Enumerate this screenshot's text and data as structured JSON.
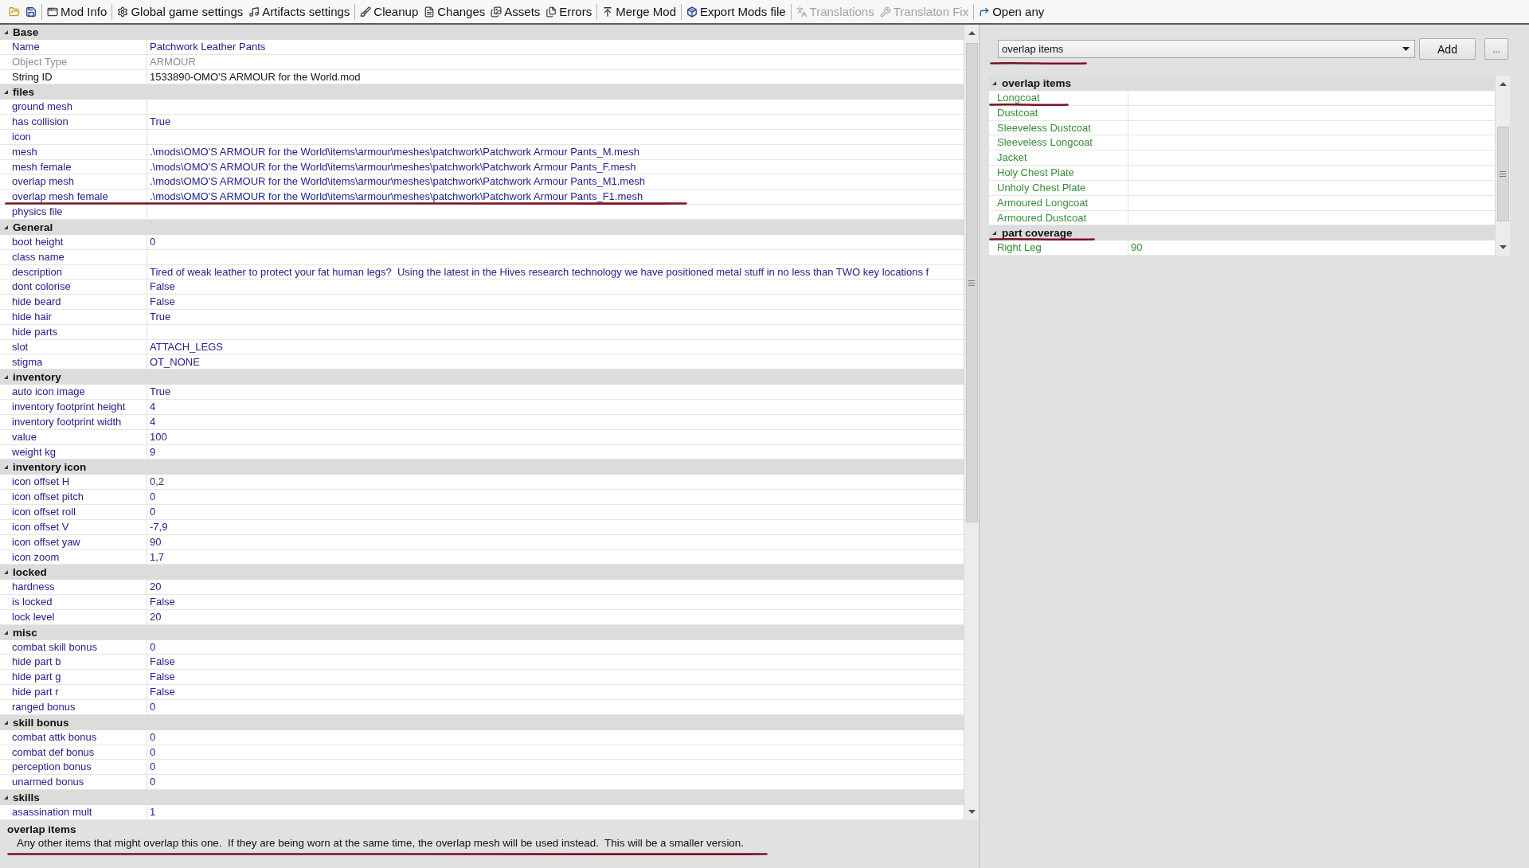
{
  "toolbar": {
    "groups": [
      {
        "buttons": [
          {
            "disabled": false
          },
          {
            "disabled": false
          }
        ]
      },
      {
        "buttons": [
          {
            "label": "Mod Info",
            "disabled": false
          }
        ]
      },
      {
        "buttons": [
          {
            "label": "Global game settings",
            "disabled": false
          },
          {
            "label": "Artifacts settings",
            "disabled": false
          }
        ]
      },
      {
        "buttons": [
          {
            "label": "Cleanup",
            "disabled": false
          },
          {
            "label": "Changes",
            "disabled": false
          },
          {
            "label": "Assets",
            "disabled": false
          },
          {
            "label": "Errors",
            "disabled": false
          }
        ]
      },
      {
        "buttons": [
          {
            "label": "Merge Mod",
            "disabled": false
          }
        ]
      },
      {
        "buttons": [
          {
            "label": "Export Mods file",
            "disabled": false
          }
        ]
      },
      {
        "buttons": [
          {
            "label": "Translations",
            "disabled": true
          },
          {
            "label": "Translaton Fix",
            "disabled": true
          }
        ]
      },
      {
        "buttons": [
          {
            "label": "Open any",
            "disabled": false
          }
        ]
      }
    ]
  },
  "properties": {
    "categories": [
      {
        "name": "Base",
        "expanded": true,
        "marked": false,
        "rows": [
          {
            "name": "Name",
            "value": "Patchwork Leather Pants",
            "kind": "property",
            "marked": false
          },
          {
            "name": "Object Type",
            "value": "ARMOUR",
            "kind": "readonly",
            "marked": false
          },
          {
            "name": "String ID",
            "value": "1533890-OMO'S ARMOUR for the World.mod",
            "kind": "identifier",
            "marked": false
          }
        ]
      },
      {
        "name": "files",
        "expanded": true,
        "marked": false,
        "rows": [
          {
            "name": "ground mesh",
            "kind": "property",
            "marked": false
          },
          {
            "name": "has collision",
            "value": "True",
            "kind": "property",
            "marked": false
          },
          {
            "name": "icon",
            "kind": "property",
            "marked": false
          },
          {
            "name": "mesh",
            "value": ".\\mods\\OMO'S ARMOUR for the World\\items\\armour\\meshes\\patchwork\\Patchwork Armour Pants_M.mesh",
            "kind": "property",
            "marked": false
          },
          {
            "name": "mesh female",
            "value": ".\\mods\\OMO'S ARMOUR for the World\\items\\armour\\meshes\\patchwork\\Patchwork Armour Pants_F.mesh",
            "kind": "property",
            "marked": false
          },
          {
            "name": "overlap mesh",
            "value": ".\\mods\\OMO'S ARMOUR for the World\\items\\armour\\meshes\\patchwork\\Patchwork Armour Pants_M1.mesh",
            "kind": "property",
            "marked": false
          },
          {
            "name": "overlap mesh female",
            "value": ".\\mods\\OMO'S ARMOUR for the World\\items\\armour\\meshes\\patchwork\\Patchwork Armour Pants_F1.mesh",
            "kind": "property",
            "marked": true
          },
          {
            "name": "physics file",
            "kind": "property",
            "marked": false
          }
        ]
      },
      {
        "name": "General",
        "expanded": true,
        "marked": false,
        "rows": [
          {
            "name": "boot height",
            "value": "0",
            "kind": "property",
            "marked": false
          },
          {
            "name": "class name",
            "kind": "property",
            "marked": false
          },
          {
            "name": "description",
            "value": "Tired of weak leather to protect your fat human legs?  Using the latest in the Hives research technology we have positioned metal stuff in no less than TWO key locations f",
            "kind": "property",
            "marked": false
          },
          {
            "name": "dont colorise",
            "value": "False",
            "kind": "property",
            "marked": false
          },
          {
            "name": "hide beard",
            "value": "False",
            "kind": "property",
            "marked": false
          },
          {
            "name": "hide hair",
            "value": "True",
            "kind": "property",
            "marked": false
          },
          {
            "name": "hide parts",
            "kind": "property",
            "marked": false
          },
          {
            "name": "slot",
            "value": "ATTACH_LEGS",
            "kind": "property",
            "marked": false
          },
          {
            "name": "stigma",
            "value": "OT_NONE",
            "kind": "property",
            "marked": false
          }
        ]
      },
      {
        "name": "inventory",
        "expanded": true,
        "marked": false,
        "rows": [
          {
            "name": "auto icon image",
            "value": "True",
            "kind": "property",
            "marked": false
          },
          {
            "name": "inventory footprint height",
            "value": "4",
            "kind": "property",
            "marked": false
          },
          {
            "name": "inventory footprint width",
            "value": "4",
            "kind": "property",
            "marked": false
          },
          {
            "name": "value",
            "value": "100",
            "kind": "property",
            "marked": false
          },
          {
            "name": "weight kg",
            "value": "9",
            "kind": "property",
            "marked": false
          }
        ]
      },
      {
        "name": "inventory icon",
        "expanded": true,
        "marked": false,
        "rows": [
          {
            "name": "icon offset H",
            "value": "0,2",
            "kind": "property",
            "marked": false
          },
          {
            "name": "icon offset pitch",
            "value": "0",
            "kind": "property",
            "marked": false
          },
          {
            "name": "icon offset roll",
            "value": "0",
            "kind": "property",
            "marked": false
          },
          {
            "name": "icon offset V",
            "value": "-7,9",
            "kind": "property",
            "marked": false
          },
          {
            "name": "icon offset yaw",
            "value": "90",
            "kind": "property",
            "marked": false
          },
          {
            "name": "icon zoom",
            "value": "1,7",
            "kind": "property",
            "marked": false
          }
        ]
      },
      {
        "name": "locked",
        "expanded": true,
        "marked": false,
        "rows": [
          {
            "name": "hardness",
            "value": "20",
            "kind": "property",
            "marked": false
          },
          {
            "name": "is locked",
            "value": "False",
            "kind": "property",
            "marked": false
          },
          {
            "name": "lock level",
            "value": "20",
            "kind": "property",
            "marked": false
          }
        ]
      },
      {
        "name": "misc",
        "expanded": true,
        "marked": false,
        "rows": [
          {
            "name": "combat skill bonus",
            "value": "0",
            "kind": "property",
            "marked": false
          },
          {
            "name": "hide part b",
            "value": "False",
            "kind": "property",
            "marked": false
          },
          {
            "name": "hide part g",
            "value": "False",
            "kind": "property",
            "marked": false
          },
          {
            "name": "hide part r",
            "value": "False",
            "kind": "property",
            "marked": false
          },
          {
            "name": "ranged bonus",
            "value": "0",
            "kind": "property",
            "marked": false
          }
        ]
      },
      {
        "name": "skill bonus",
        "expanded": true,
        "marked": false,
        "rows": [
          {
            "name": "combat attk bonus",
            "value": "0",
            "kind": "property",
            "marked": false
          },
          {
            "name": "combat def bonus",
            "value": "0",
            "kind": "property",
            "marked": false
          },
          {
            "name": "perception bonus",
            "value": "0",
            "kind": "property",
            "marked": false
          },
          {
            "name": "unarmed bonus",
            "value": "0",
            "kind": "property",
            "marked": false
          }
        ]
      },
      {
        "name": "skills",
        "expanded": true,
        "marked": false,
        "rows": [
          {
            "name": "asassination mult",
            "value": "1",
            "kind": "property",
            "marked": false
          }
        ]
      }
    ]
  },
  "help": {
    "title": "overlap items",
    "text": "Any other items that might overlap this one.  If they are being worn at the same time, the overlap mesh will be used instead.  This will be a smaller version.",
    "marked": true
  },
  "reference_panel": {
    "selector": {
      "value": "overlap items",
      "marked": true
    },
    "buttons": [
      {
        "label": "Add"
      },
      {
        "label": "..."
      }
    ],
    "grid": {
      "categories": [
        {
          "name": "overlap items",
          "expanded": true,
          "marked": false,
          "rows": [
            {
              "name": "Longcoat",
              "kind": "reference",
              "marked": true
            },
            {
              "name": "Dustcoat",
              "kind": "reference",
              "marked": false
            },
            {
              "name": "Sleeveless Dustcoat",
              "kind": "reference",
              "marked": false
            },
            {
              "name": "Sleeveless Longcoat",
              "kind": "reference",
              "marked": false
            },
            {
              "name": "Jacket",
              "kind": "reference",
              "marked": false
            },
            {
              "name": "Holy Chest Plate",
              "kind": "reference",
              "marked": false
            },
            {
              "name": "Unholy Chest Plate",
              "kind": "reference",
              "marked": false
            },
            {
              "name": "Armoured Longcoat",
              "kind": "reference",
              "marked": false
            },
            {
              "name": "Armoured Dustcoat",
              "kind": "reference",
              "marked": false
            }
          ]
        },
        {
          "name": "part coverage",
          "expanded": true,
          "marked": true,
          "rows": [
            {
              "name": "Right Leg",
              "value": "90",
              "kind": "reference",
              "marked": false
            }
          ]
        }
      ]
    }
  }
}
